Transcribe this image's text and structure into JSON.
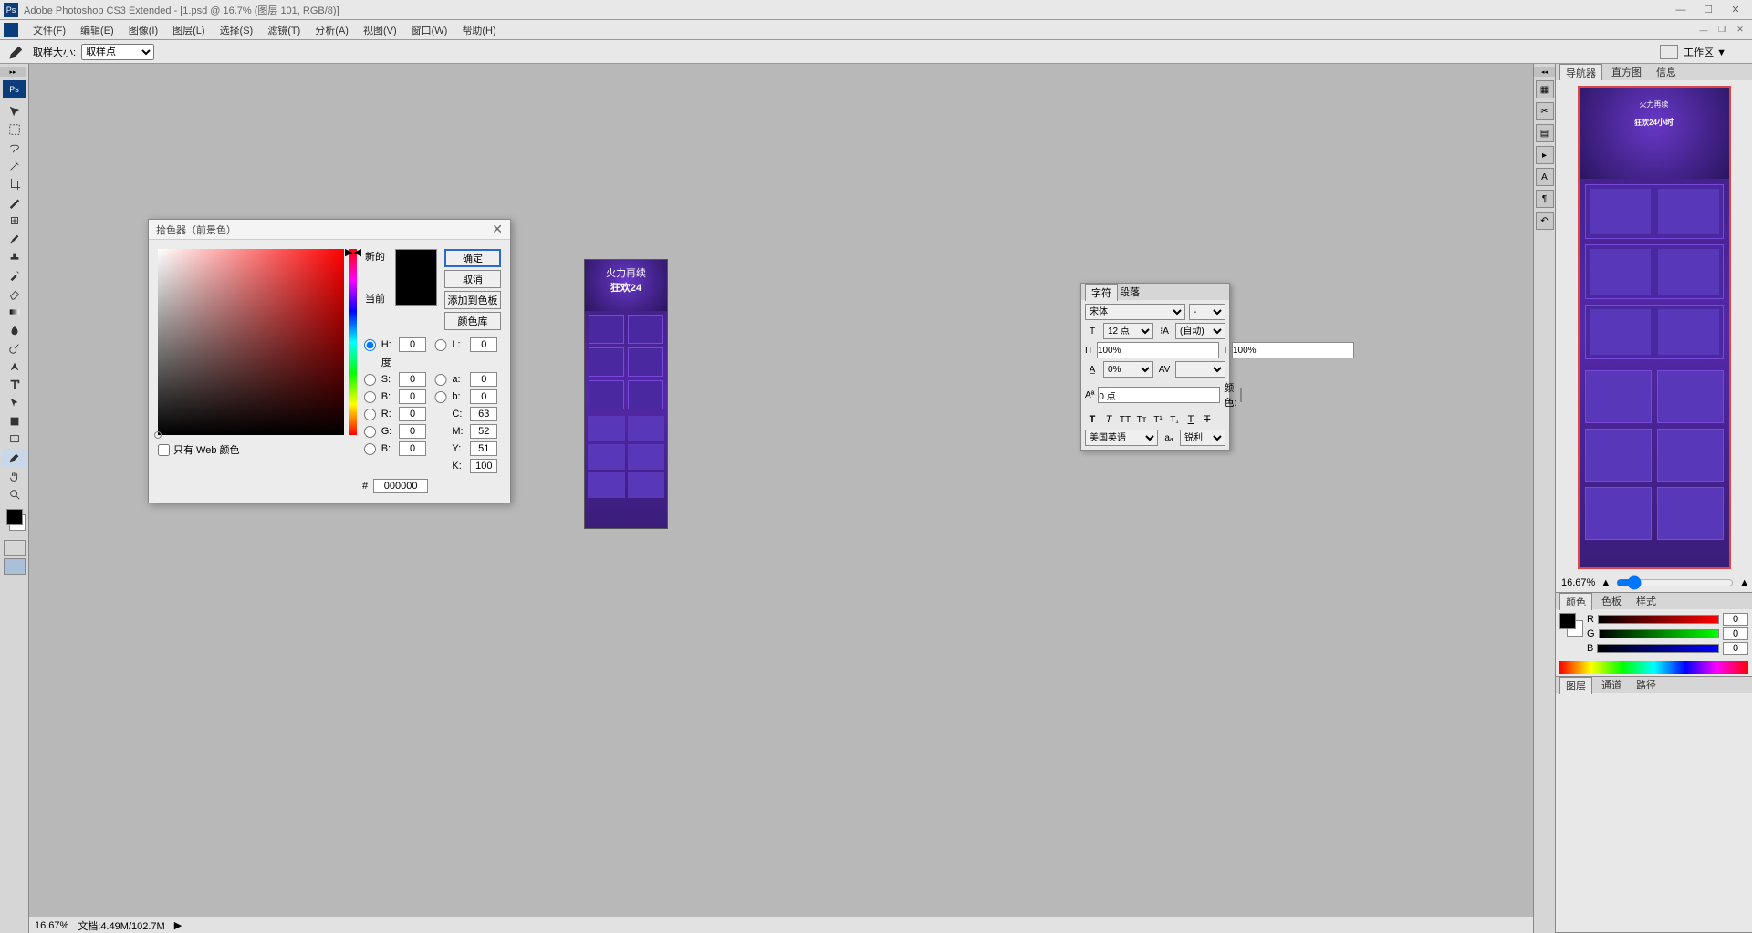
{
  "title": "Adobe Photoshop CS3 Extended - [1.psd @ 16.7% (图层 101, RGB/8)]",
  "menu": [
    "文件(F)",
    "编辑(E)",
    "图像(I)",
    "图层(L)",
    "选择(S)",
    "滤镜(T)",
    "分析(A)",
    "视图(V)",
    "窗口(W)",
    "帮助(H)"
  ],
  "options": {
    "sample_label": "取样大小:",
    "sample_value": "取样点",
    "workspace_label": "工作区 ▼"
  },
  "toolbar": {
    "badge": "Ps",
    "tools": [
      "move",
      "marquee",
      "lasso",
      "wand",
      "crop",
      "slice",
      "healing",
      "brush",
      "stamp",
      "history-brush",
      "eraser",
      "gradient",
      "blur",
      "dodge",
      "pen",
      "type",
      "path-select",
      "shape",
      "notes",
      "eyedropper",
      "hand",
      "zoom"
    ]
  },
  "dialog": {
    "title": "拾色器（前景色）",
    "new_label": "新的",
    "cur_label": "当前",
    "ok": "确定",
    "cancel": "取消",
    "add": "添加到色板",
    "lib": "颜色库",
    "H": "0",
    "H_unit": "度",
    "S": "0",
    "S_unit": "%",
    "Bval": "0",
    "B_unit": "%",
    "R": "0",
    "G": "0",
    "Bl": "0",
    "L": "0",
    "a": "0",
    "b": "0",
    "C": "63",
    "M": "52",
    "Y": "51",
    "K": "100",
    "cmyk_unit": "%",
    "hex_label": "#",
    "hex": "000000",
    "webonly": "只有 Web 颜色"
  },
  "char": {
    "tab1": "字符",
    "tab2": "段落",
    "font": "宋体",
    "style": "-",
    "size": "12 点",
    "leading": "(自动)",
    "tracking": "100%",
    "kerning": "100%",
    "vscale": "0%",
    "baseline": "0 点",
    "color_label": "颜色:",
    "lang": "美国英语",
    "aa": "锐利"
  },
  "nav": {
    "tab1": "导航器",
    "tab2": "直方图",
    "tab3": "信息",
    "zoom": "16.67%",
    "doc_title_small": "火力再续",
    "doc_title_big": "狂欢24",
    "doc_title_suffix": "小时"
  },
  "colorp": {
    "tab1": "颜色",
    "tab2": "色板",
    "tab3": "样式",
    "R": "0",
    "G": "0",
    "B": "0"
  },
  "layers": {
    "tab1": "图层",
    "tab2": "通道",
    "tab3": "路径"
  },
  "status": {
    "zoom": "16.67%",
    "docinfo": "文档:4.49M/102.7M"
  }
}
